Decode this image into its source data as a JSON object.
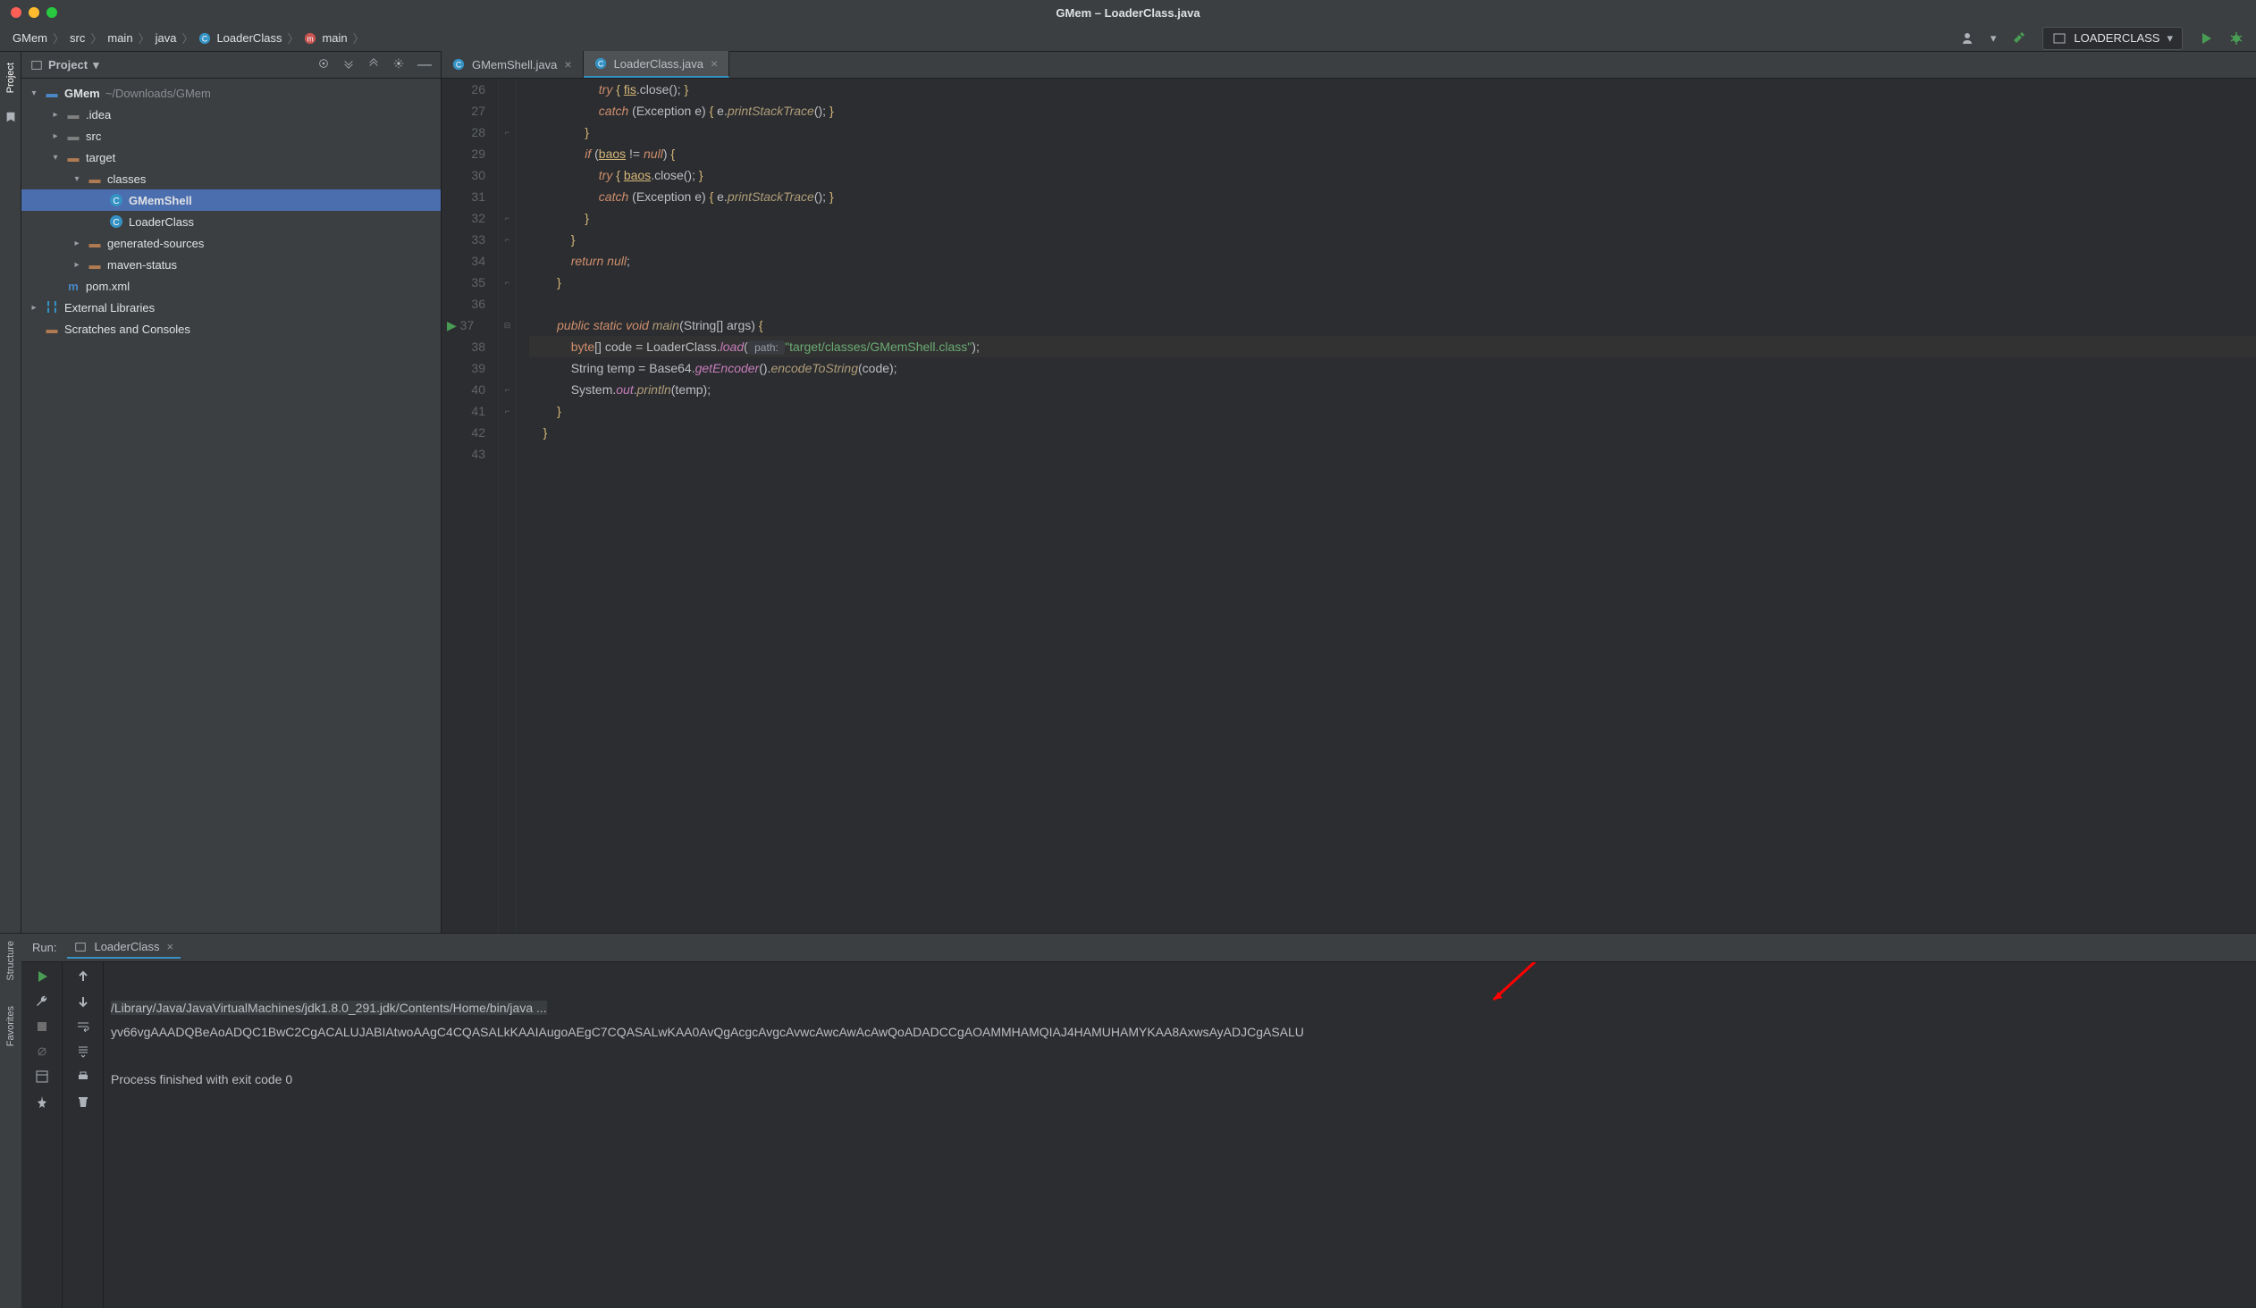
{
  "window": {
    "title": "GMem – LoaderClass.java"
  },
  "breadcrumbs": [
    "GMem",
    "src",
    "main",
    "java",
    "LoaderClass",
    "main"
  ],
  "runconfig": "LOADERCLASS",
  "treeHeader": "Project",
  "tree": {
    "root": {
      "name": "GMem",
      "path": "~/Downloads/GMem"
    },
    "idea": ".idea",
    "src": "src",
    "target": "target",
    "classes": "classes",
    "gmemshell": "GMemShell",
    "loaderclass": "LoaderClass",
    "gensrc": "generated-sources",
    "mvnstatus": "maven-status",
    "pom": "pom.xml",
    "extlib": "External Libraries",
    "scratch": "Scratches and Consoles"
  },
  "tabs": [
    {
      "label": "GMemShell.java",
      "active": false
    },
    {
      "label": "LoaderClass.java",
      "active": true
    }
  ],
  "lineStart": 26,
  "code": [
    {
      "n": 26,
      "indent": 5,
      "tokens": [
        {
          "t": "try",
          "c": "kw"
        },
        {
          "t": " "
        },
        {
          "t": "{",
          "c": "br"
        },
        {
          "t": " "
        },
        {
          "t": "fis",
          "c": "field"
        },
        {
          "t": ".close(); ",
          "c": "par"
        },
        {
          "t": "}",
          "c": "br"
        }
      ]
    },
    {
      "n": 27,
      "indent": 5,
      "tokens": [
        {
          "t": "catch",
          "c": "kw"
        },
        {
          "t": " "
        },
        {
          "t": "(",
          "c": "par"
        },
        {
          "t": "Exception e",
          "c": "par"
        },
        {
          "t": ")",
          "c": "par"
        },
        {
          "t": " "
        },
        {
          "t": "{",
          "c": "br"
        },
        {
          "t": " e.",
          "c": "par"
        },
        {
          "t": "printStackTrace",
          "c": "fn"
        },
        {
          "t": "(); ",
          "c": "par"
        },
        {
          "t": "}",
          "c": "br"
        }
      ]
    },
    {
      "n": 28,
      "indent": 4,
      "fold": "e",
      "tokens": [
        {
          "t": "}",
          "c": "br"
        }
      ]
    },
    {
      "n": 29,
      "indent": 4,
      "tokens": [
        {
          "t": "if",
          "c": "kw"
        },
        {
          "t": " "
        },
        {
          "t": "(",
          "c": "par"
        },
        {
          "t": "baos",
          "c": "field"
        },
        {
          "t": " != ",
          "c": "par"
        },
        {
          "t": "null",
          "c": "kw"
        },
        {
          "t": ") ",
          "c": "par"
        },
        {
          "t": "{",
          "c": "br"
        }
      ]
    },
    {
      "n": 30,
      "indent": 5,
      "tokens": [
        {
          "t": "try",
          "c": "kw"
        },
        {
          "t": " "
        },
        {
          "t": "{",
          "c": "br"
        },
        {
          "t": " "
        },
        {
          "t": "baos",
          "c": "field"
        },
        {
          "t": ".close(); ",
          "c": "par"
        },
        {
          "t": "}",
          "c": "br"
        }
      ]
    },
    {
      "n": 31,
      "indent": 5,
      "tokens": [
        {
          "t": "catch",
          "c": "kw"
        },
        {
          "t": " "
        },
        {
          "t": "(",
          "c": "par"
        },
        {
          "t": "Exception e",
          "c": "par"
        },
        {
          "t": ")",
          "c": "par"
        },
        {
          "t": " "
        },
        {
          "t": "{",
          "c": "br"
        },
        {
          "t": " e.",
          "c": "par"
        },
        {
          "t": "printStackTrace",
          "c": "fn"
        },
        {
          "t": "(); ",
          "c": "par"
        },
        {
          "t": "}",
          "c": "br"
        }
      ]
    },
    {
      "n": 32,
      "indent": 4,
      "fold": "e",
      "tokens": [
        {
          "t": "}",
          "c": "br"
        }
      ]
    },
    {
      "n": 33,
      "indent": 3,
      "fold": "e",
      "tokens": [
        {
          "t": "}",
          "c": "br"
        }
      ]
    },
    {
      "n": 34,
      "indent": 3,
      "tokens": [
        {
          "t": "return",
          "c": "kw"
        },
        {
          "t": " "
        },
        {
          "t": "null",
          "c": "kw"
        },
        {
          "t": ";",
          "c": "par"
        }
      ]
    },
    {
      "n": 35,
      "indent": 2,
      "fold": "e",
      "tokens": [
        {
          "t": "}",
          "c": "br"
        }
      ]
    },
    {
      "n": 36,
      "indent": 0,
      "tokens": []
    },
    {
      "n": 37,
      "indent": 2,
      "run": true,
      "fold": "s",
      "tokens": [
        {
          "t": "public static void",
          "c": "kw"
        },
        {
          "t": " "
        },
        {
          "t": "main",
          "c": "fn"
        },
        {
          "t": "(",
          "c": "par"
        },
        {
          "t": "String[] args",
          "c": "par"
        },
        {
          "t": ") ",
          "c": "par"
        },
        {
          "t": "{",
          "c": "br"
        }
      ]
    },
    {
      "n": 38,
      "indent": 3,
      "hl": true,
      "tokens": [
        {
          "t": "byte",
          "c": "kw2"
        },
        {
          "t": "[] ",
          "c": "par"
        },
        {
          "t": "code",
          "c": "var"
        },
        {
          "t": " = ",
          "c": "par"
        },
        {
          "t": "LoaderClass",
          "c": "cls"
        },
        {
          "t": ".",
          "c": "par"
        },
        {
          "t": "load",
          "c": "static"
        },
        {
          "t": "(",
          "c": "par"
        },
        {
          "t": " path: ",
          "c": "hint"
        },
        {
          "t": "\"target/classes/GMemShell.class\"",
          "c": "str"
        },
        {
          "t": ");",
          "c": "par"
        }
      ]
    },
    {
      "n": 39,
      "indent": 3,
      "tokens": [
        {
          "t": "String ",
          "c": "par"
        },
        {
          "t": "temp",
          "c": "var"
        },
        {
          "t": " = Base64.",
          "c": "par"
        },
        {
          "t": "getEncoder",
          "c": "static"
        },
        {
          "t": "().",
          "c": "par"
        },
        {
          "t": "encodeToString",
          "c": "fn"
        },
        {
          "t": "(code);",
          "c": "par"
        }
      ]
    },
    {
      "n": 40,
      "indent": 3,
      "fold": "e",
      "tokens": [
        {
          "t": "System.",
          "c": "par"
        },
        {
          "t": "out",
          "c": "member"
        },
        {
          "t": ".",
          "c": "par"
        },
        {
          "t": "println",
          "c": "fn"
        },
        {
          "t": "(temp);",
          "c": "par"
        }
      ]
    },
    {
      "n": 41,
      "indent": 2,
      "fold": "e",
      "tokens": [
        {
          "t": "}",
          "c": "br"
        }
      ]
    },
    {
      "n": 42,
      "indent": 1,
      "tokens": [
        {
          "t": "}",
          "c": "br"
        }
      ]
    },
    {
      "n": 43,
      "indent": 0,
      "tokens": []
    }
  ],
  "run": {
    "label": "Run:",
    "tab": "LoaderClass",
    "cmd": "/Library/Java/JavaVirtualMachines/jdk1.8.0_291.jdk/Contents/Home/bin/java ...",
    "out": "yv66vgAAADQBeAoADQC1BwC2CgACALUJABIAtwoAAgC4CQASALkKAAIAugoAEgC7CQASALwKAA0AvQgAcgcAvgcAvwcAwcAwAcAwQoADADCCgAOAMMHAMQIAJ4HAMUHAMYKAA8AxwsAyADJCgASALU",
    "exit": "Process finished with exit code 0"
  },
  "sidebarLabels": {
    "project": "Project",
    "structure": "Structure",
    "favorites": "Favorites"
  }
}
